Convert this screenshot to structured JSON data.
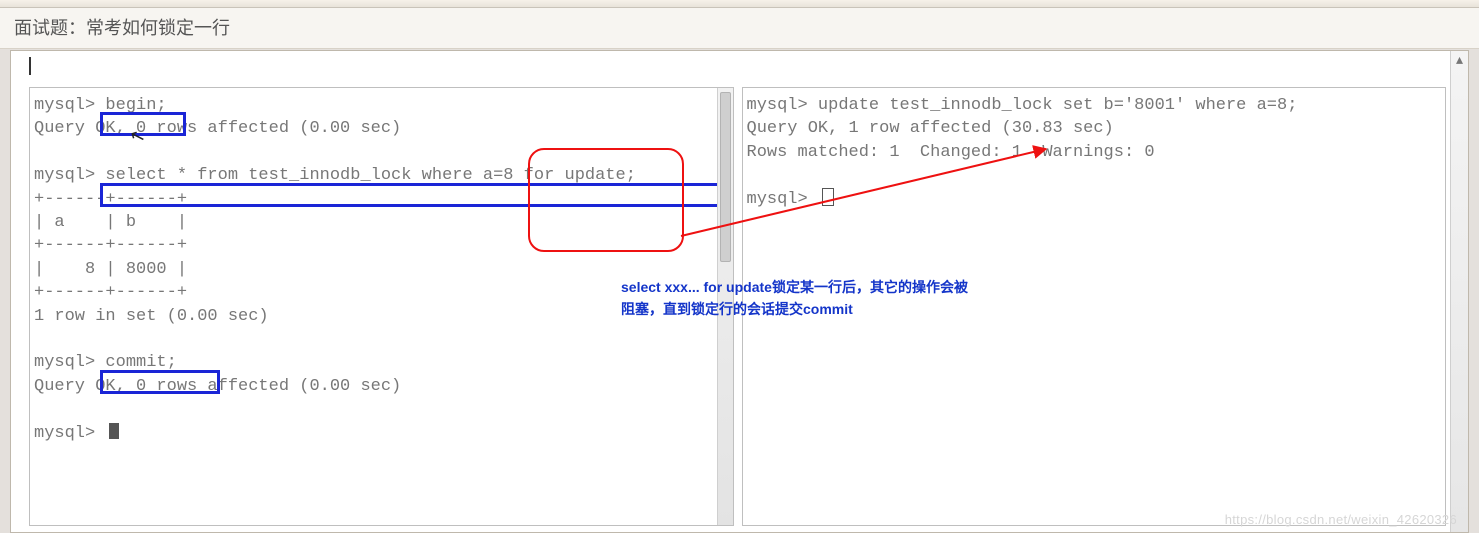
{
  "header": {
    "title": "面试题：常考如何锁定一行"
  },
  "left": {
    "p1": "mysql> begin;",
    "ok1": "Query OK, 0 rows affected (0.00 sec)",
    "blank1": "",
    "p2": "mysql> select * from test_innodb_lock where a=8 for update;",
    "sep1": "+------+------+",
    "hdr": "| a    | b    |",
    "sep2": "+------+------+",
    "row": "|    8 | 8000 |",
    "sep3": "+------+------+",
    "rows": "1 row in set (0.00 sec)",
    "blank2": "",
    "p3": "mysql> commit;",
    "ok3": "Query OK, 0 rows affected (0.00 sec)",
    "blank3": "",
    "p4": "mysql> "
  },
  "right": {
    "p1": "mysql> update test_innodb_lock set b='8001' where a=8;",
    "ok": "Query OK, 1 row affected (30.83 sec)",
    "match": "Rows matched: 1  Changed: 1  Warnings: 0",
    "blank": "",
    "p2": "mysql> "
  },
  "note": {
    "line1": "select xxx... for update锁定某一行后，其它的操作会被",
    "line2": "阻塞，直到锁定行的会话提交commit"
  },
  "watermark": "https://blog.csdn.net/weixin_42620326"
}
